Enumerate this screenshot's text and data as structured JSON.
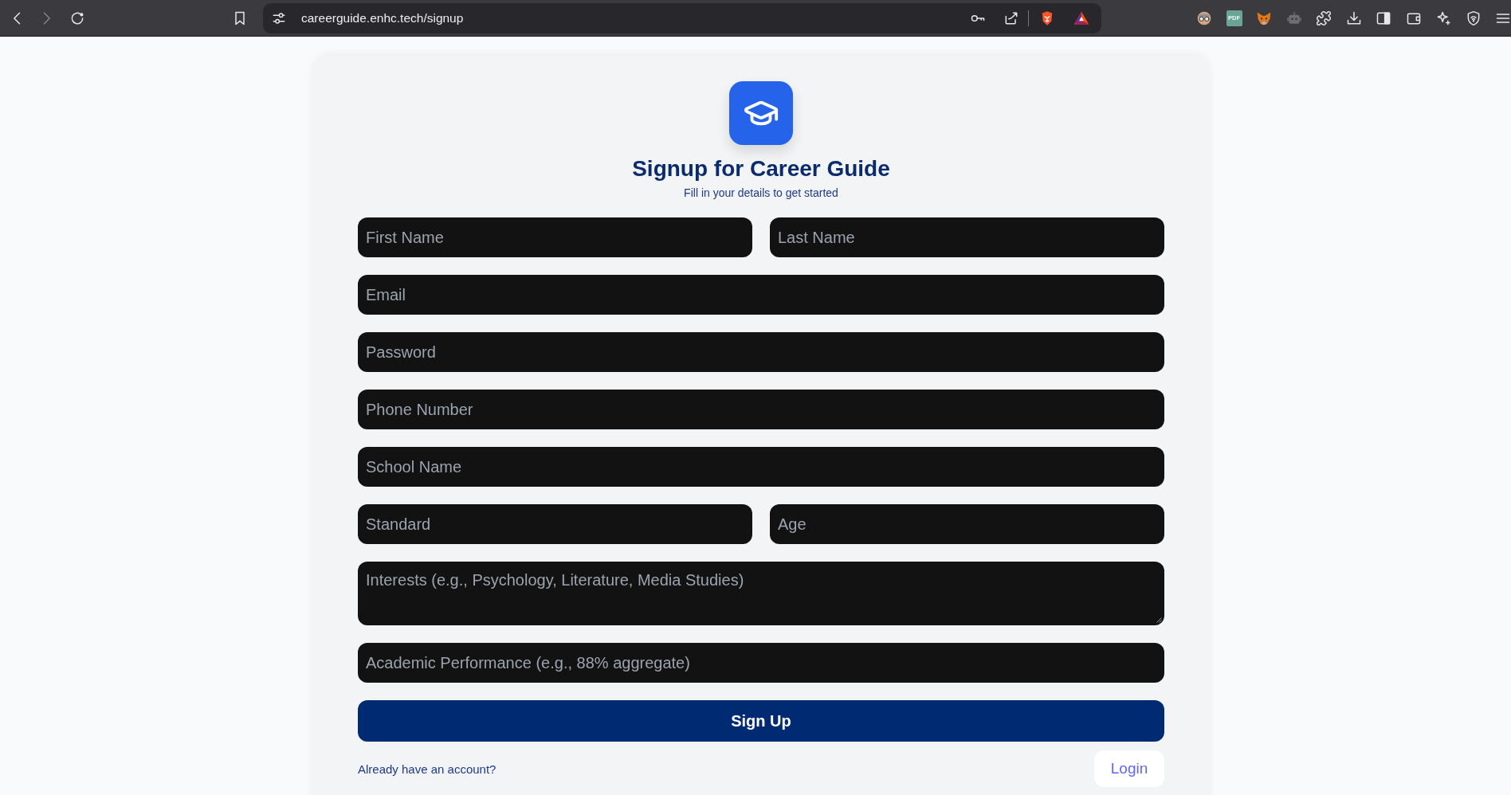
{
  "browser": {
    "back_disabled": false,
    "forward_disabled": true,
    "url": "careerguide.enhc.tech/signup",
    "pdf_extension_label": "PDF"
  },
  "signup": {
    "title": "Signup for Career Guide",
    "subtitle": "Fill in your details to get started",
    "rows": [
      {
        "fields": [
          {
            "kind": "input",
            "placeholder": "First Name"
          },
          {
            "kind": "input",
            "placeholder": "Last Name"
          }
        ]
      },
      {
        "fields": [
          {
            "kind": "input",
            "placeholder": "Email"
          }
        ]
      },
      {
        "fields": [
          {
            "kind": "input",
            "placeholder": "Password"
          }
        ]
      },
      {
        "fields": [
          {
            "kind": "input",
            "placeholder": "Phone Number"
          }
        ]
      },
      {
        "fields": [
          {
            "kind": "input",
            "placeholder": "School Name"
          }
        ]
      },
      {
        "fields": [
          {
            "kind": "input",
            "placeholder": "Standard"
          },
          {
            "kind": "input",
            "placeholder": "Age"
          }
        ]
      },
      {
        "fields": [
          {
            "kind": "textarea",
            "placeholder": "Interests (e.g., Psychology, Literature, Media Studies)"
          }
        ]
      },
      {
        "fields": [
          {
            "kind": "input",
            "placeholder": "Academic Performance (e.g., 88% aggregate)"
          }
        ]
      }
    ],
    "submit_button": "Sign Up",
    "login_prompt": "Already have an account?",
    "login_button": "Login"
  }
}
